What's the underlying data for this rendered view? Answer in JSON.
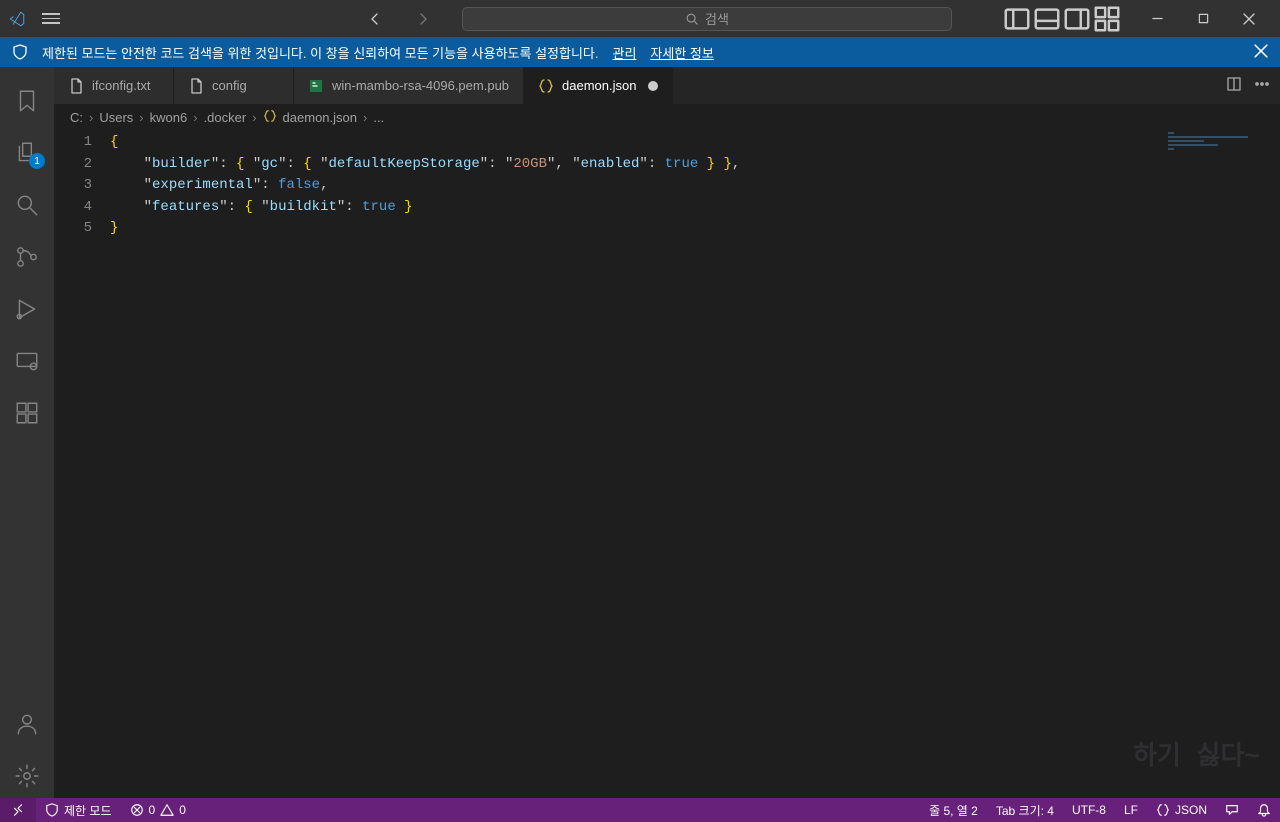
{
  "titlebar": {
    "search_placeholder": "검색"
  },
  "infobar": {
    "message": "제한된 모드는 안전한 코드 검색을 위한 것입니다. 이 창을 신뢰하여 모든 기능을 사용하도록 설정합니다.",
    "manage": "관리",
    "learn": "자세한 정보"
  },
  "activity": {
    "badge": "1"
  },
  "tabs": [
    {
      "label": "ifconfig.txt",
      "active": false,
      "dirty": false,
      "icon": "file"
    },
    {
      "label": "config",
      "active": false,
      "dirty": false,
      "icon": "file"
    },
    {
      "label": "win-mambo-rsa-4096.pem.pub",
      "active": false,
      "dirty": false,
      "icon": "publisher"
    },
    {
      "label": "daemon.json",
      "active": true,
      "dirty": true,
      "icon": "json"
    }
  ],
  "breadcrumb": {
    "segs": [
      "C:",
      "Users",
      "kwon6",
      ".docker"
    ],
    "file": "daemon.json",
    "tail": "..."
  },
  "code": {
    "lines": [
      "1",
      "2",
      "3",
      "4",
      "5"
    ],
    "json": {
      "builder": {
        "gc": {
          "defaultKeepStorage": "20GB",
          "enabled": true
        }
      },
      "experimental": false,
      "features": {
        "buildkit": true
      }
    }
  },
  "status": {
    "restricted": "제한 모드",
    "errors": "0",
    "warnings": "0",
    "position": "줄 5, 열 2",
    "tabsize": "Tab 크기: 4",
    "encoding": "UTF-8",
    "eol": "LF",
    "language": "JSON"
  },
  "watermark": "하기 싫다~"
}
